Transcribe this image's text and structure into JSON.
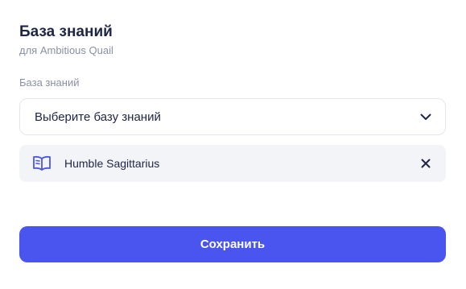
{
  "header": {
    "title": "База знаний",
    "subtitle": "для Ambitious Quail"
  },
  "knowledge_base": {
    "label": "База знаний",
    "select_placeholder": "Выберите базу знаний",
    "selected_items": [
      {
        "label": "Humble Sagittarius",
        "icon": "book-open-icon"
      }
    ]
  },
  "actions": {
    "save_label": "Сохранить"
  },
  "colors": {
    "accent": "#4a55f0",
    "text_primary": "#1f2545",
    "text_secondary": "#8a8fa5",
    "chip_background": "#f3f4f7",
    "border": "#e4e6ee"
  }
}
